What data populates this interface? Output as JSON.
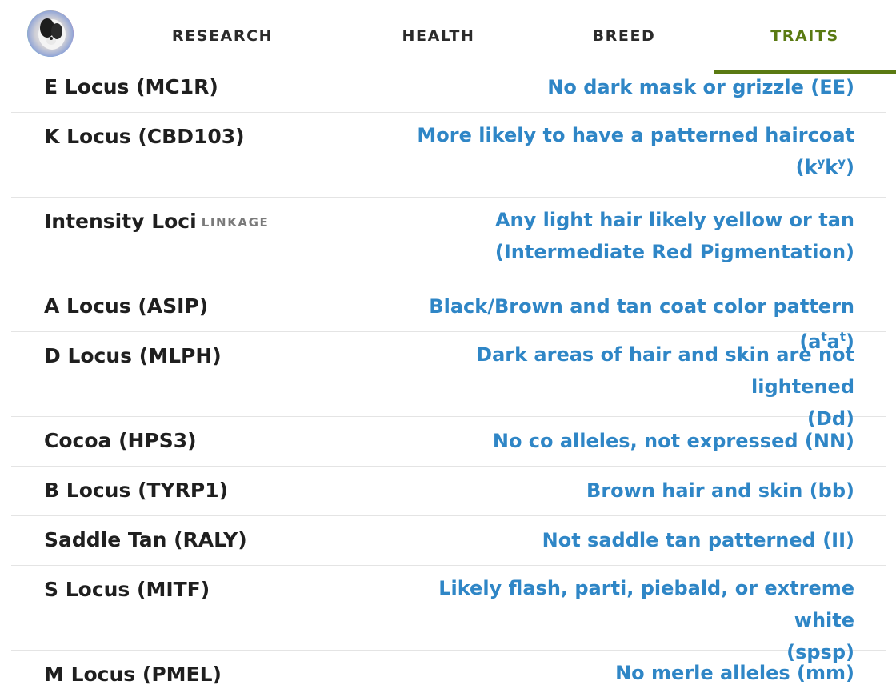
{
  "nav": {
    "tabs": [
      {
        "label": "RESEARCH"
      },
      {
        "label": "HEALTH"
      },
      {
        "label": "BREED"
      },
      {
        "label": "TRAITS",
        "active": true
      }
    ],
    "active_color": "#5a7a12"
  },
  "colors": {
    "value_link": "#2f86c6",
    "trait_name": "#1f1f1f",
    "divider": "#e4e4e4"
  },
  "traits": [
    {
      "name": "E Locus (MC1R)",
      "value": "No dark mask or grizzle (EE)"
    },
    {
      "name": "K Locus (CBD103)",
      "value_main": "More likely to have a patterned haircoat",
      "value_genotype": [
        "k",
        "y",
        "k",
        "y"
      ]
    },
    {
      "name": "Intensity Loci",
      "badge": "LINKAGE",
      "value_line1": "Any light hair likely yellow or tan",
      "value_line2": "(Intermediate Red Pigmentation)"
    },
    {
      "name": "A Locus (ASIP)",
      "value_main": "Black/Brown and tan coat color pattern",
      "value_genotype": [
        "a",
        "t",
        "a",
        "t"
      ]
    },
    {
      "name": "D Locus (MLPH)",
      "value_line1": "Dark areas of hair and skin are not lightened",
      "value_line2": "(Dd)"
    },
    {
      "name": "Cocoa (HPS3)",
      "value": "No co alleles, not expressed (NN)"
    },
    {
      "name": "B Locus (TYRP1)",
      "value": "Brown hair and skin (bb)"
    },
    {
      "name": "Saddle Tan (RALY)",
      "value": "Not saddle tan patterned (II)"
    },
    {
      "name": "S Locus (MITF)",
      "value_line1": "Likely flash, parti, piebald, or extreme white",
      "value_line2": "(spsp)"
    },
    {
      "name": "M Locus (PMEL)",
      "value": "No merle alleles (mm)"
    }
  ]
}
